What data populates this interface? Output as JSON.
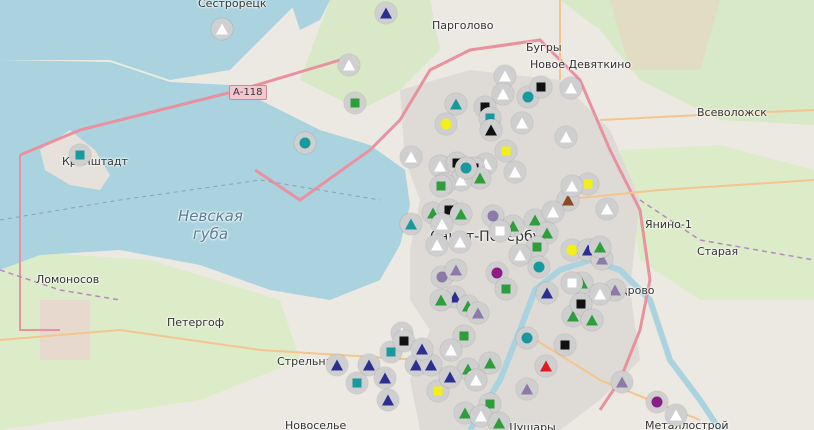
{
  "map": {
    "places": {
      "sestroretsk": "Сестрорецк",
      "pargolovo": "Парголово",
      "bugry": "Бугры",
      "novoe_devyatkino": "Новое Девяткино",
      "vsevolozhsk": "Всеволожск",
      "kronshtadt": "Кронштадт",
      "yanino": "Янино-1",
      "staraya": "Старая",
      "lomonosov": "Ломоносов",
      "peterhof": "Петергоф",
      "strelna": "Стрельна",
      "novoselye": "Новоселье",
      "shushary": "Шушары",
      "metallostroy": "Металлострой",
      "kudrovo": "дрово",
      "spb": "Санкт-Петербург"
    },
    "water": {
      "line1": "Невская",
      "line2": "губа"
    },
    "road_shield": "А-118",
    "marker_colors": {
      "white": "#ffffff",
      "green": "#2e9e3a",
      "navy": "#2b2f8f",
      "teal": "#17999e",
      "purple": "#8c7aa8",
      "black": "#111111",
      "yellow": "#f2ef1a",
      "red": "#e01b1b",
      "magenta": "#8b1e86",
      "brown": "#8a4a20"
    },
    "markers": [
      [
        "tri",
        "navy"
      ],
      [
        "tri",
        "white"
      ],
      [
        "tri",
        "white"
      ],
      [
        "tri",
        "white"
      ],
      [
        "sq",
        "green"
      ],
      [
        "ci",
        "teal"
      ],
      [
        "sq",
        "teal"
      ],
      [
        "tri",
        "white"
      ],
      [
        "tri",
        "white"
      ],
      [
        "sq",
        "black"
      ],
      [
        "sq",
        "black"
      ],
      [
        "ci",
        "teal"
      ],
      [
        "tri",
        "white"
      ],
      [
        "tri",
        "white"
      ],
      [
        "tri",
        "teal"
      ],
      [
        "sq",
        "black"
      ],
      [
        "sq",
        "teal"
      ],
      [
        "ci",
        "yellow"
      ],
      [
        "tri",
        "black"
      ],
      [
        "tri",
        "white"
      ],
      [
        "tri",
        "white"
      ],
      [
        "sq",
        "yellow"
      ],
      [
        "tri",
        "white"
      ],
      [
        "tri",
        "white"
      ],
      [
        "sq",
        "black"
      ],
      [
        "tri",
        "green"
      ],
      [
        "tri",
        "white"
      ],
      [
        "tri",
        "white"
      ],
      [
        "ci",
        "teal"
      ],
      [
        "sq",
        "green"
      ],
      [
        "sq",
        "yellow"
      ],
      [
        "tri",
        "brown"
      ],
      [
        "tri",
        "white"
      ],
      [
        "tri",
        "white"
      ],
      [
        "tri",
        "green"
      ],
      [
        "sq",
        "black"
      ],
      [
        "tri",
        "teal"
      ],
      [
        "tri",
        "green"
      ],
      [
        "tri",
        "white"
      ],
      [
        "ci",
        "purple"
      ],
      [
        "tri",
        "green"
      ],
      [
        "tri",
        "green"
      ],
      [
        "tri",
        "white"
      ],
      [
        "tri",
        "green"
      ],
      [
        "sq",
        "green"
      ],
      [
        "ci",
        "yellow"
      ],
      [
        "tri",
        "navy"
      ],
      [
        "tri",
        "purple"
      ],
      [
        "sq",
        "white"
      ],
      [
        "tri",
        "white"
      ],
      [
        "tri",
        "white"
      ],
      [
        "ci",
        "purple"
      ],
      [
        "tri",
        "purple"
      ],
      [
        "ci",
        "magenta"
      ],
      [
        "tri",
        "white"
      ],
      [
        "ci",
        "teal"
      ],
      [
        "tri",
        "green"
      ],
      [
        "tri",
        "navy"
      ],
      [
        "tri",
        "green"
      ],
      [
        "sq",
        "green"
      ],
      [
        "sq",
        "white"
      ],
      [
        "tri",
        "green"
      ],
      [
        "tri",
        "purple"
      ],
      [
        "tri",
        "white"
      ],
      [
        "sq",
        "black"
      ],
      [
        "tri",
        "green"
      ],
      [
        "tri",
        "navy"
      ],
      [
        "tri",
        "green"
      ],
      [
        "tri",
        "green"
      ],
      [
        "ci",
        "teal"
      ],
      [
        "tri",
        "purple"
      ],
      [
        "sq",
        "black"
      ],
      [
        "tri",
        "red"
      ],
      [
        "tri",
        "navy"
      ],
      [
        "tri",
        "navy"
      ],
      [
        "sq",
        "teal"
      ],
      [
        "tri",
        "navy"
      ],
      [
        "tri",
        "navy"
      ],
      [
        "sq",
        "teal"
      ],
      [
        "tri",
        "white"
      ],
      [
        "tri",
        "navy"
      ],
      [
        "sq",
        "black"
      ],
      [
        "tri",
        "navy"
      ],
      [
        "tri",
        "green"
      ],
      [
        "tri",
        "green"
      ],
      [
        "tri",
        "white"
      ],
      [
        "sq",
        "yellow"
      ],
      [
        "tri",
        "navy"
      ],
      [
        "tri",
        "purple"
      ],
      [
        "tri",
        "purple"
      ],
      [
        "ci",
        "magenta"
      ],
      [
        "tri",
        "white"
      ],
      [
        "sq",
        "green"
      ],
      [
        "tri",
        "green"
      ],
      [
        "tri",
        "white"
      ],
      [
        "tri",
        "green"
      ],
      [
        "tri",
        "navy"
      ],
      [
        "sq",
        "green"
      ],
      [
        "tri",
        "white"
      ]
    ]
  }
}
